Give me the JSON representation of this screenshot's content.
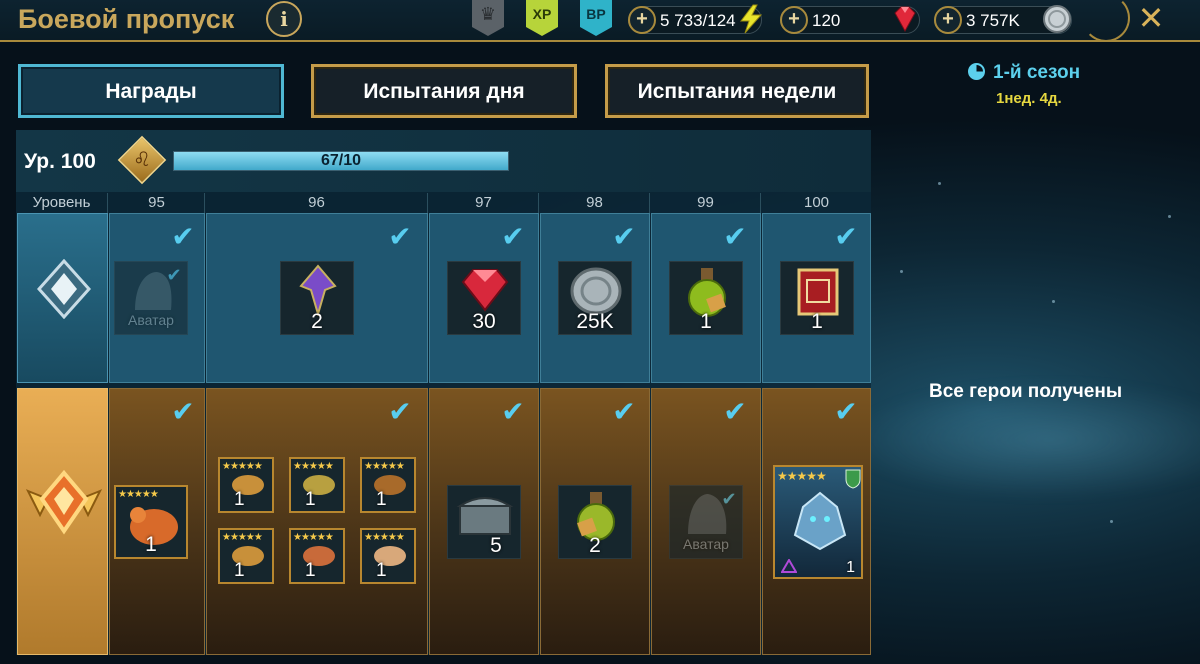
{
  "header": {
    "title": "Боевой пропуск",
    "info_label": "i",
    "badges": {
      "crown": "♛",
      "xp": "XP",
      "bp": "BP"
    },
    "resources": {
      "energy": "5 733/124",
      "gems": "120",
      "silver": "3 757K"
    },
    "plus": "+",
    "close": "✕"
  },
  "tabs": {
    "rewards": "Награды",
    "daily": "Испытания дня",
    "weekly": "Испытания недели"
  },
  "season": {
    "name": "1-й сезон",
    "time_left": "1нед. 4д."
  },
  "level": {
    "label": "Ур. 100",
    "progress_text": "67/10",
    "progress_fraction": 1.0
  },
  "columns": {
    "header": "Уровень",
    "levels": [
      "95",
      "96",
      "97",
      "98",
      "99",
      "100"
    ]
  },
  "free_track": {
    "items": [
      {
        "type": "avatar",
        "label": "Аватар"
      },
      {
        "type": "artifact",
        "qty": "2"
      },
      {
        "type": "gem",
        "qty": "30"
      },
      {
        "type": "silver",
        "qty": "25K"
      },
      {
        "type": "potion",
        "qty": "1"
      },
      {
        "type": "tome",
        "qty": "1"
      }
    ]
  },
  "paid_track": {
    "items": [
      {
        "type": "chicken",
        "qty": "1"
      },
      {
        "type": "chicken-set",
        "qty": [
          "1",
          "1",
          "1",
          "1",
          "1",
          "1"
        ]
      },
      {
        "type": "chest",
        "qty": "5"
      },
      {
        "type": "potion",
        "qty": "2"
      },
      {
        "type": "avatar",
        "label": "Аватар"
      },
      {
        "type": "hero",
        "qty": "1"
      }
    ]
  },
  "check": "✔",
  "stars": "★★★★★",
  "right_panel": {
    "message": "Все герои получены"
  },
  "colors": {
    "gold": "#c9a75c",
    "cyan": "#5cd0ec",
    "check": "#58cdef",
    "bar": "#42a9cb"
  }
}
